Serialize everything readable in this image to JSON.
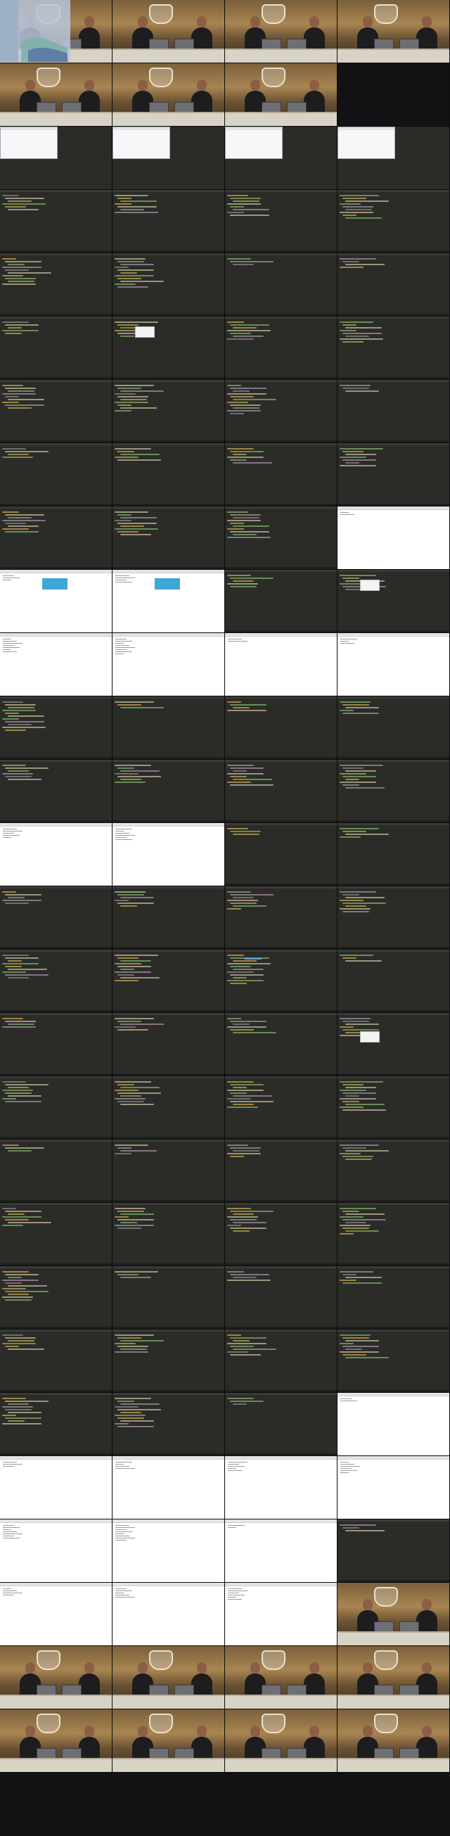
{
  "sheet": {
    "columns": 4,
    "frames": [
      "presenter",
      "presenter",
      "presenter",
      "presenter",
      "presenter",
      "presenter",
      "presenter",
      "blank-dark",
      "dialog",
      "dialog",
      "dialog",
      "dialog",
      "editor",
      "editor",
      "editor",
      "editor",
      "editor",
      "editor",
      "editor",
      "editor",
      "editor",
      "editor-popup",
      "editor",
      "editor",
      "editor",
      "editor",
      "editor",
      "editor",
      "editor",
      "editor",
      "editor",
      "editor",
      "editor",
      "editor",
      "editor",
      "browser",
      "browser-page",
      "browser-page",
      "editor",
      "editor-popup",
      "browser",
      "browser",
      "browser",
      "browser",
      "editor",
      "editor",
      "editor",
      "editor",
      "editor",
      "editor",
      "editor",
      "editor",
      "browser",
      "browser",
      "editor",
      "editor",
      "editor",
      "editor",
      "editor",
      "editor",
      "editor",
      "editor",
      "editor-highlight",
      "editor",
      "editor",
      "editor",
      "editor",
      "editor-popup",
      "editor",
      "editor",
      "editor",
      "editor",
      "editor",
      "editor",
      "editor",
      "editor",
      "editor",
      "editor",
      "editor",
      "editor",
      "editor",
      "editor",
      "editor",
      "editor",
      "editor",
      "editor",
      "editor",
      "editor",
      "editor",
      "editor",
      "editor",
      "browser",
      "browser",
      "browser",
      "browser",
      "browser",
      "browser",
      "browser",
      "browser",
      "editor",
      "browser",
      "browser",
      "browser",
      "presenter",
      "presenter",
      "presenter",
      "presenter",
      "presenter",
      "presenter",
      "presenter",
      "presenter",
      "presenter"
    ]
  },
  "colors": {
    "editor_bg": "#2b2c28",
    "studio_wood": "#a98552",
    "browser_bg": "#ffffff",
    "code_keyword": "#d4a84b",
    "code_string": "#7fb86a"
  },
  "icons": {
    "watermark": "shield-logo-icon",
    "studio_logo": "shield-logo-icon"
  }
}
